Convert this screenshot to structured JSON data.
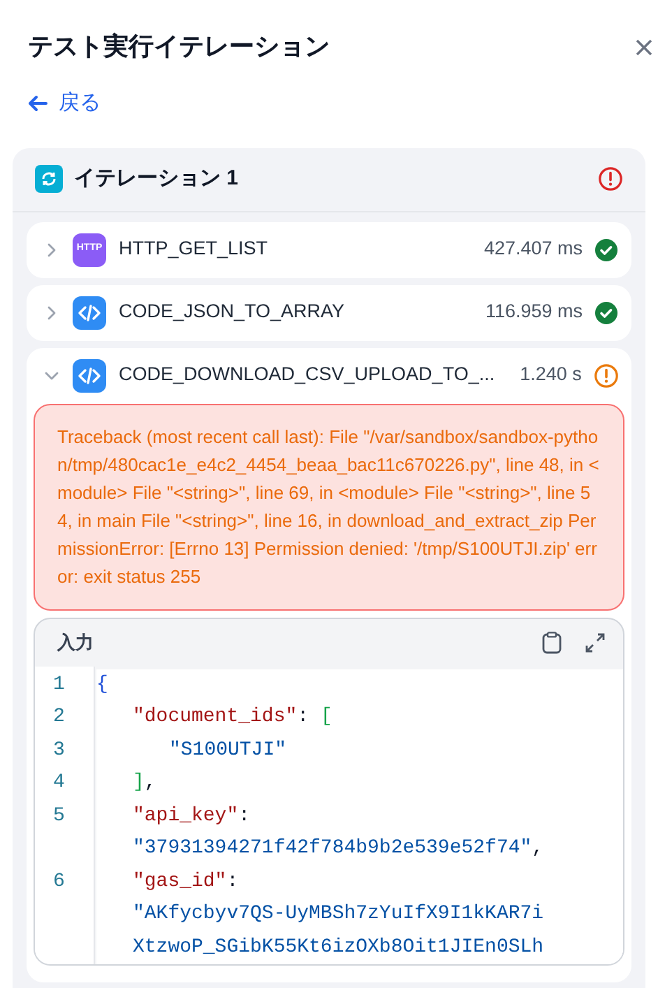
{
  "title": "テスト実行イテレーション",
  "back_link": "戻る",
  "iteration": {
    "title": "イテレーション 1",
    "failed": true,
    "steps": [
      {
        "kind": "http",
        "icon_text": "HTTP",
        "name": "HTTP_GET_LIST",
        "duration": "427.407 ms",
        "failed": false,
        "expanded": false
      },
      {
        "kind": "code",
        "name": "CODE_JSON_TO_ARRAY",
        "duration": "116.959 ms",
        "failed": false,
        "expanded": false
      },
      {
        "kind": "code",
        "name": "CODE_DOWNLOAD_CSV_UPLOAD_TO_...",
        "duration": "1.240 s",
        "failed": true,
        "expanded": true,
        "error": "Traceback (most recent call last): File \"/var/sandbox/sandbox-python/tmp/480cac1e_e4c2_4454_beaa_bac11c670226.py\", line 48, in <module> File \"<string>\", line 69, in <module> File \"<string>\", line 54, in main File \"<string>\", line 16, in download_and_extract_zip PermissionError: [Errno 13] Permission denied: '/tmp/S100UTJI.zip' error: exit status 255",
        "input": {
          "label": "入力",
          "lines": [
            {
              "number": "1",
              "tokens": [
                {
                  "kind": "brace",
                  "text": "{"
                }
              ]
            },
            {
              "number": "2",
              "tokens": [
                {
                  "kind": "key",
                  "text": "\"document_ids\""
                },
                {
                  "kind": "punct",
                  "text": ": "
                },
                {
                  "kind": "bracket",
                  "text": "["
                }
              ]
            },
            {
              "number": "3",
              "tokens": [
                {
                  "kind": "string",
                  "text": "\"S100UTJI\""
                }
              ]
            },
            {
              "number": "4",
              "tokens": [
                {
                  "kind": "bracket",
                  "text": "]"
                },
                {
                  "kind": "punct",
                  "text": ","
                }
              ]
            },
            {
              "number": "5",
              "tokens": [
                {
                  "kind": "key",
                  "text": "\"api_key\""
                },
                {
                  "kind": "punct",
                  "text": ":"
                }
              ]
            },
            {
              "tokens": [
                {
                  "kind": "string",
                  "text": "\"37931394271f42f784b9b2e539e52f74\""
                },
                {
                  "kind": "punct",
                  "text": ","
                }
              ]
            },
            {
              "number": "6",
              "tokens": [
                {
                  "kind": "key",
                  "text": "\"gas_id\""
                },
                {
                  "kind": "punct",
                  "text": ":"
                }
              ]
            },
            {
              "tokens": [
                {
                  "kind": "string",
                  "text": "\"AKfycbyv7QS-UyMBSh7zYuIfX9I1kKAR7i"
                }
              ]
            },
            {
              "tokens": [
                {
                  "kind": "string",
                  "text": "XtzwoP_SGibK55Kt6izOXb8Oit1JIEn0SLh"
                }
              ]
            }
          ]
        }
      }
    ]
  }
}
